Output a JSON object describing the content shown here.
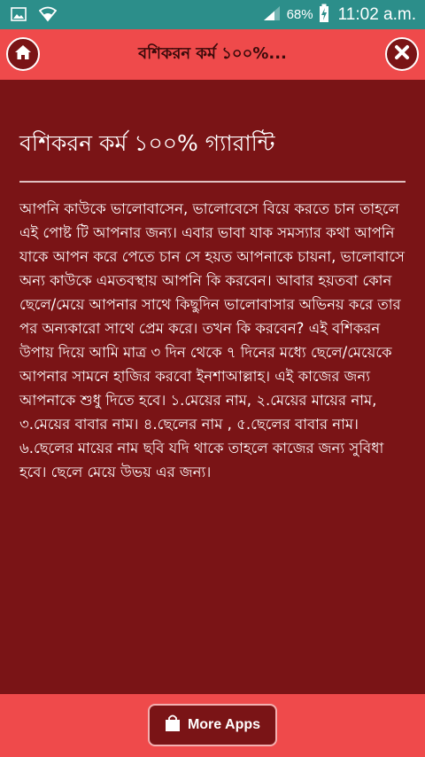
{
  "status_bar": {
    "battery_percent": "68%",
    "time": "11:02 a.m.",
    "icons": [
      "image-icon",
      "wifi-icon",
      "signal-icon",
      "battery-charging-icon"
    ]
  },
  "app_bar": {
    "title": "বশিকরন কর্ম ১০০%...",
    "home_icon": "home-icon",
    "close_icon": "close-icon",
    "accent_color": "#ef4a4b"
  },
  "article": {
    "title": "বশিকরন কর্ম ১০০% গ্যারান্টি",
    "body": "আপনি কাউকে ভালোবাসেন, ভালোবেসে বিয়ে করতে চান তাহলে এই পোষ্ট টি আপনার জন্য। এবার ভাবা যাক সমস্যার কথা আপনি যাকে আপন করে পেতে চান সে হয়ত আপনাকে চায়না, ভালোবাসে অন্য কাউকে এমতবস্থায় আপনি কি করবেন। আবার হয়তবা কোন ছেলে/মেয়ে আপনার সাথে কিছুদিন ভালোবাসার অভিনয় করে তার পর অন্যকারো সাথে প্রেম করে। তখন কি করবেন? এই বশিকরন উপায় দিয়ে আমি মাত্র ৩ দিন থেকে ৭ দিনের মধ্যে ছেলে/মেয়েকে আপনার সামনে হাজির করবো ইনশাআল্লাহ। এই কাজের জন্য আপনাকে শুধু দিতে হবে। ১.মেয়ের নাম, ২.মেয়ের মায়ের নাম, ৩.মেয়ের বাবার নাম। ৪.ছেলের নাম , ৫.ছেলের বাবার নাম। ৬.ছেলের মায়ের নাম ছবি যদি থাকে তাহলে কাজের জন্য সুবিধা হবে। ছেলে মেয়ে উভয় এর জন্য।"
  },
  "bottom_bar": {
    "more_apps_label": "More Apps",
    "more_apps_icon": "shopping-bag-icon"
  },
  "colors": {
    "background": "#7a1416",
    "status_bar": "#2c8e8a",
    "app_bar": "#ef4a4b"
  }
}
